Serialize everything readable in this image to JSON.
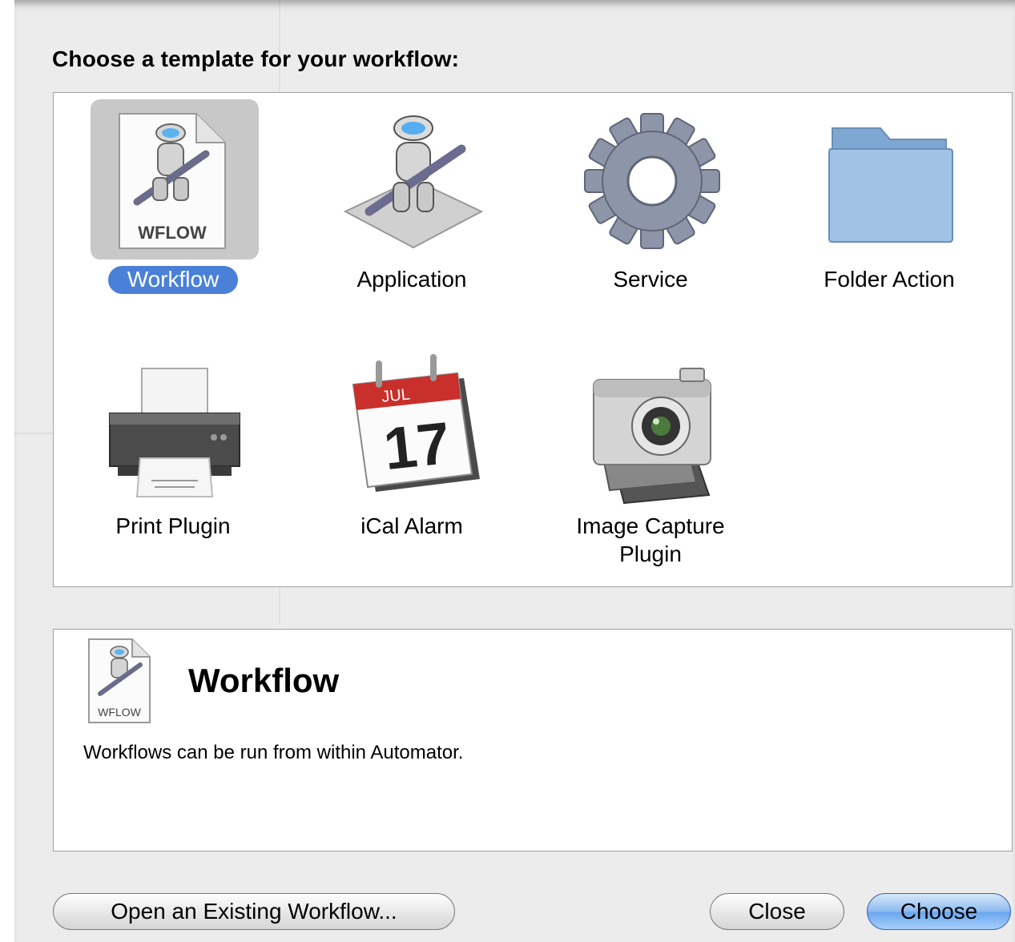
{
  "dialog": {
    "heading": "Choose a template for your workflow:"
  },
  "templates": [
    {
      "label": "Workflow",
      "icon": "workflow-document-icon",
      "selected": true,
      "badge": "WFLOW"
    },
    {
      "label": "Application",
      "icon": "automator-robot-icon",
      "selected": false
    },
    {
      "label": "Service",
      "icon": "gear-icon",
      "selected": false
    },
    {
      "label": "Folder Action",
      "icon": "folder-icon",
      "selected": false
    },
    {
      "label": "Print Plugin",
      "icon": "printer-icon",
      "selected": false
    },
    {
      "label": "iCal Alarm",
      "icon": "calendar-icon",
      "selected": false,
      "month": "JUL",
      "day": "17"
    },
    {
      "label": "Image Capture Plugin",
      "icon": "camera-icon",
      "selected": false
    }
  ],
  "description": {
    "icon": "workflow-document-icon",
    "badge": "WFLOW",
    "title": "Workflow",
    "text": "Workflows can be run from within Automator."
  },
  "buttons": {
    "open_existing": "Open an Existing Workflow...",
    "close": "Close",
    "choose": "Choose"
  },
  "colors": {
    "selection_blue": "#4a80d7",
    "default_button_blue": "#6aa6ee",
    "calendar_red": "#c9302c",
    "folder_blue": "#8fb6dd"
  }
}
